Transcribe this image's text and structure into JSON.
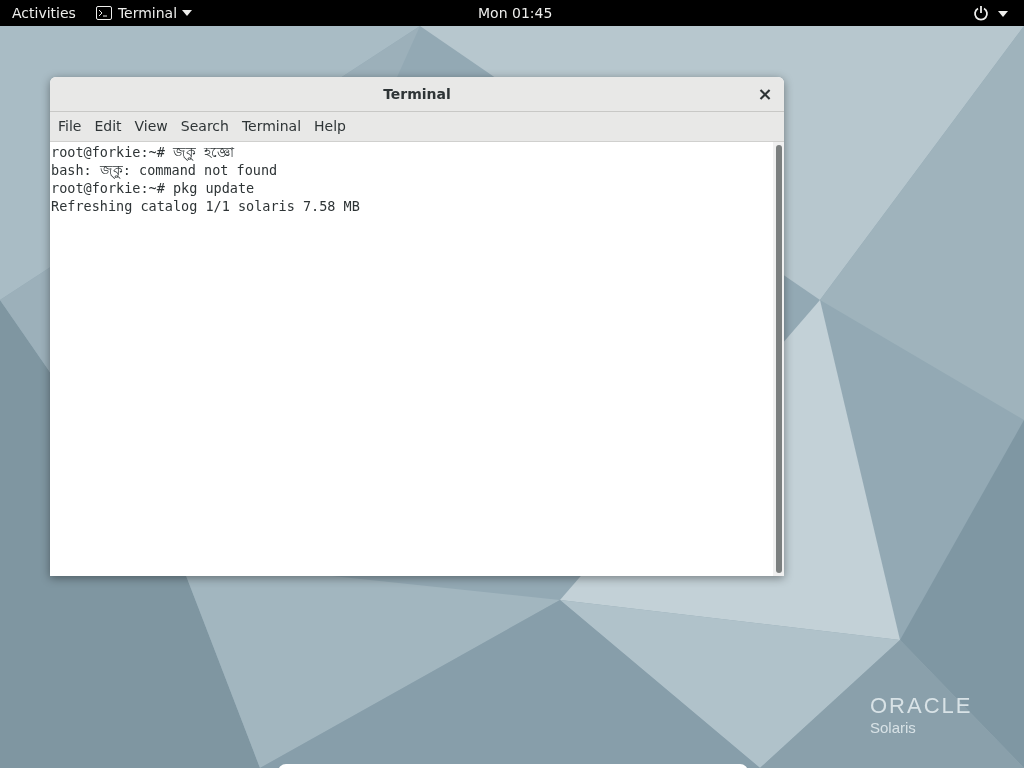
{
  "top_bar": {
    "activities": "Activities",
    "app_menu": "Terminal",
    "clock": "Mon 01:45"
  },
  "window": {
    "title": "Terminal",
    "close": "×",
    "menu": [
      "File",
      "Edit",
      "View",
      "Search",
      "Terminal",
      "Help"
    ],
    "lines": [
      "root@forkie:~# জ্কু হজ্ঞো",
      "bash: জ্কু: command not found",
      "root@forkie:~# pkg update",
      "Refreshing catalog 1/1 solaris 7.58 MB"
    ]
  },
  "logo": {
    "brand": "ORACLE",
    "product": "Solaris"
  }
}
